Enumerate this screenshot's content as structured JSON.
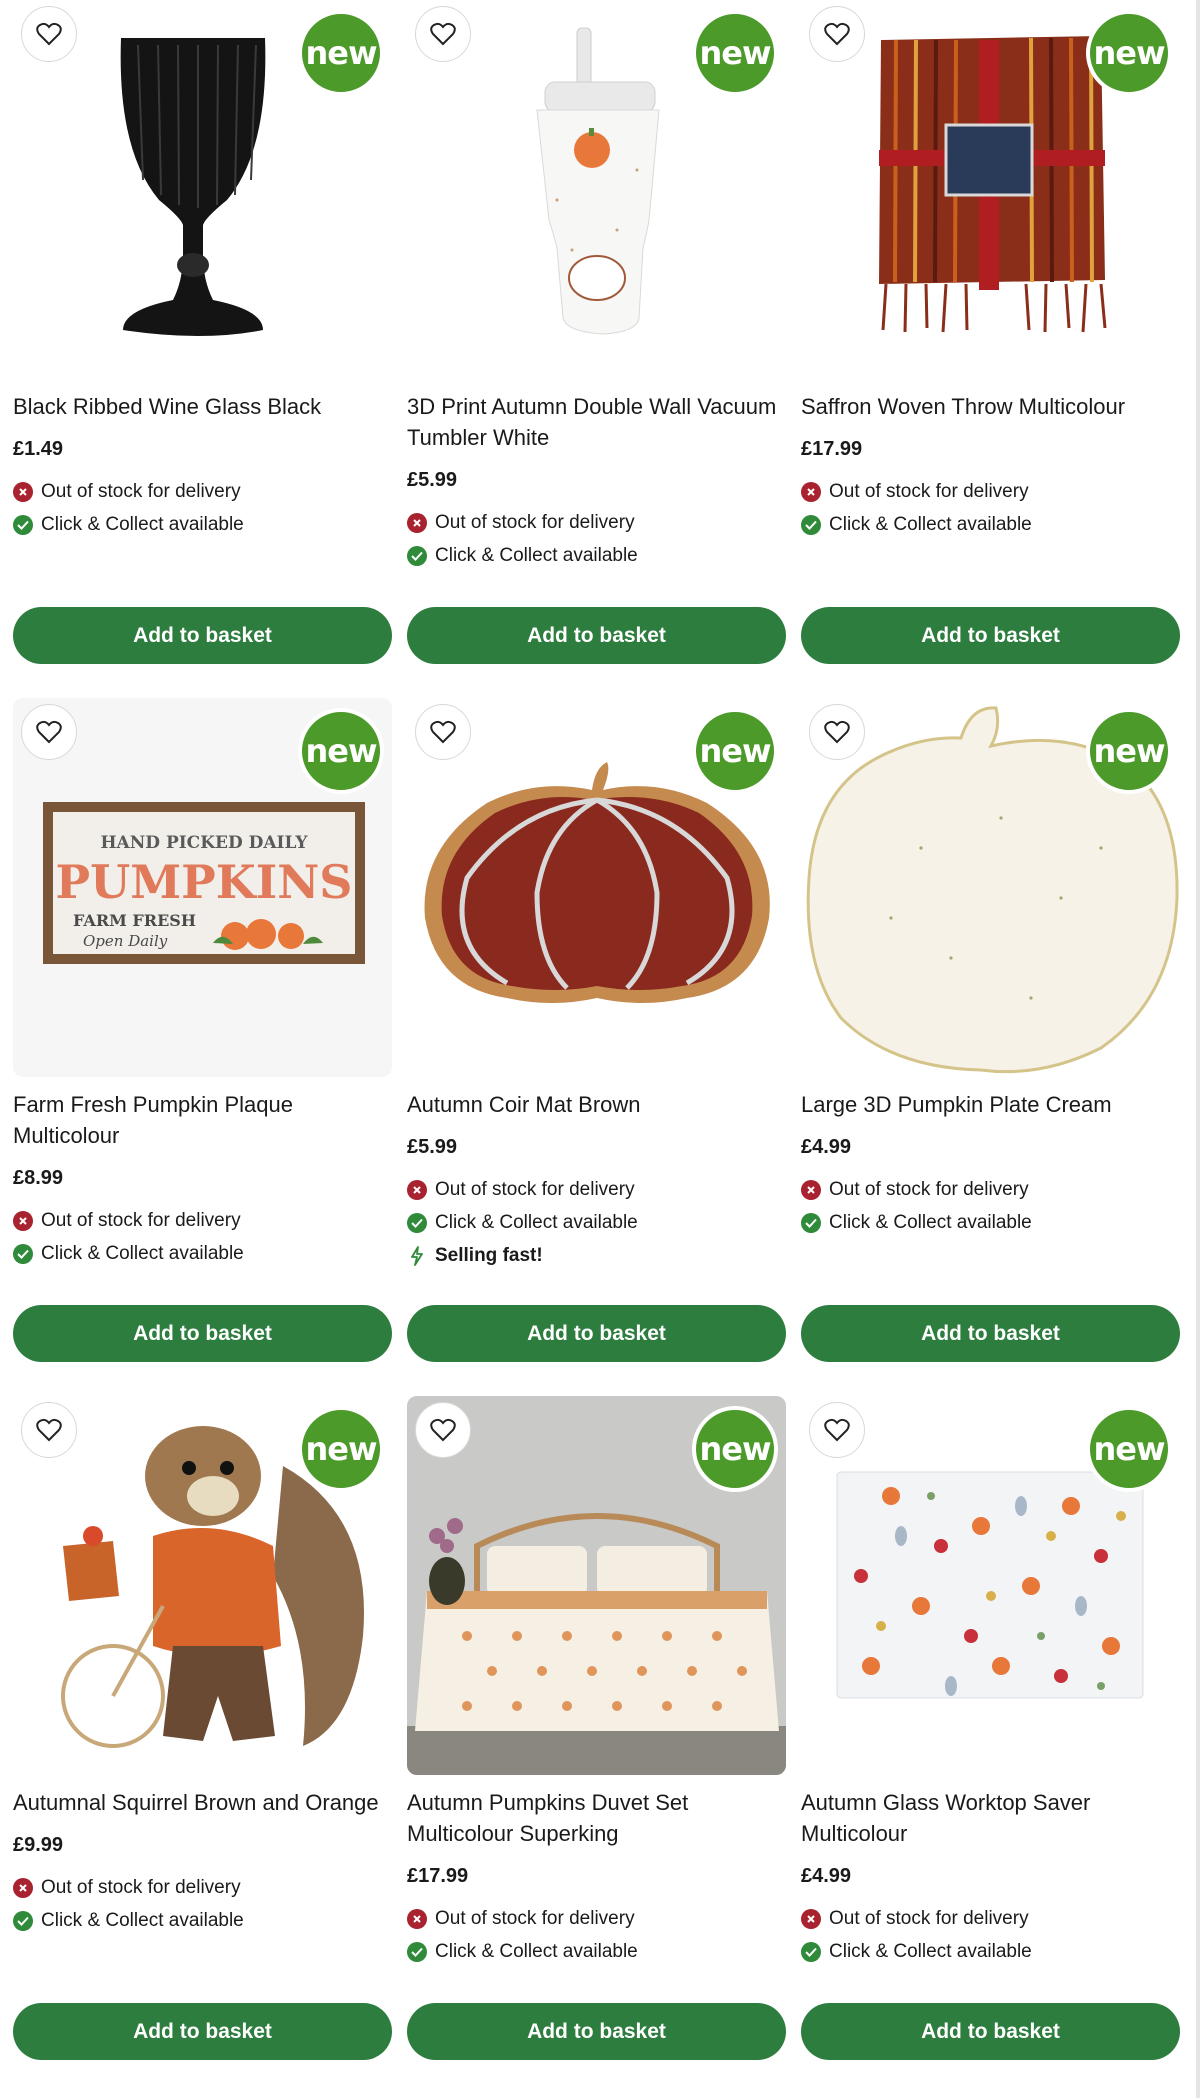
{
  "products": [
    {
      "title": "Black Ribbed Wine Glass Black",
      "price": "£1.49",
      "badge": "new",
      "statuses": [
        "Out of stock for delivery",
        "Click & Collect available"
      ],
      "button": "Add to basket"
    },
    {
      "title": "3D Print Autumn Double Wall Vacuum Tumbler White",
      "price": "£5.99",
      "badge": "new",
      "statuses": [
        "Out of stock for delivery",
        "Click & Collect available"
      ],
      "button": "Add to basket"
    },
    {
      "title": "Saffron Woven Throw Multicolour",
      "price": "£17.99",
      "badge": "new",
      "statuses": [
        "Out of stock for delivery",
        "Click & Collect available"
      ],
      "button": "Add to basket"
    },
    {
      "title": "Farm Fresh Pumpkin Plaque Multicolour",
      "price": "£8.99",
      "badge": "new",
      "statuses": [
        "Out of stock for delivery",
        "Click & Collect available"
      ],
      "button": "Add to basket",
      "image_text": [
        "HAND PICKED DAILY",
        "PUMPKINS",
        "FARM FRESH",
        "Open Daily"
      ]
    },
    {
      "title": "Autumn Coir Mat Brown",
      "price": "£5.99",
      "badge": "new",
      "statuses": [
        "Out of stock for delivery",
        "Click & Collect available"
      ],
      "selling_fast": "Selling fast!",
      "button": "Add to basket"
    },
    {
      "title": "Large 3D Pumpkin Plate Cream",
      "price": "£4.99",
      "badge": "new",
      "statuses": [
        "Out of stock for delivery",
        "Click & Collect available"
      ],
      "button": "Add to basket"
    },
    {
      "title": "Autumnal Squirrel Brown and Orange",
      "price": "£9.99",
      "badge": "new",
      "statuses": [
        "Out of stock for delivery",
        "Click & Collect available"
      ],
      "button": "Add to basket"
    },
    {
      "title": "Autumn Pumpkins Duvet Set Multicolour Superking",
      "price": "£17.99",
      "badge": "new",
      "statuses": [
        "Out of stock for delivery",
        "Click & Collect available"
      ],
      "button": "Add to basket"
    },
    {
      "title": "Autumn Glass Worktop Saver Multicolour",
      "price": "£4.99",
      "badge": "new",
      "statuses": [
        "Out of stock for delivery",
        "Click & Collect available"
      ],
      "button": "Add to basket"
    }
  ],
  "colors": {
    "brand_green": "#2d7d3f",
    "badge_green": "#4c9a2a",
    "out_of_stock_red": "#a8232f",
    "available_green": "#2f8a3a"
  },
  "icons": {
    "wishlist": "heart-icon",
    "out_of_stock": "cross-circle-icon",
    "available": "check-circle-icon",
    "selling_fast": "lightning-icon"
  }
}
